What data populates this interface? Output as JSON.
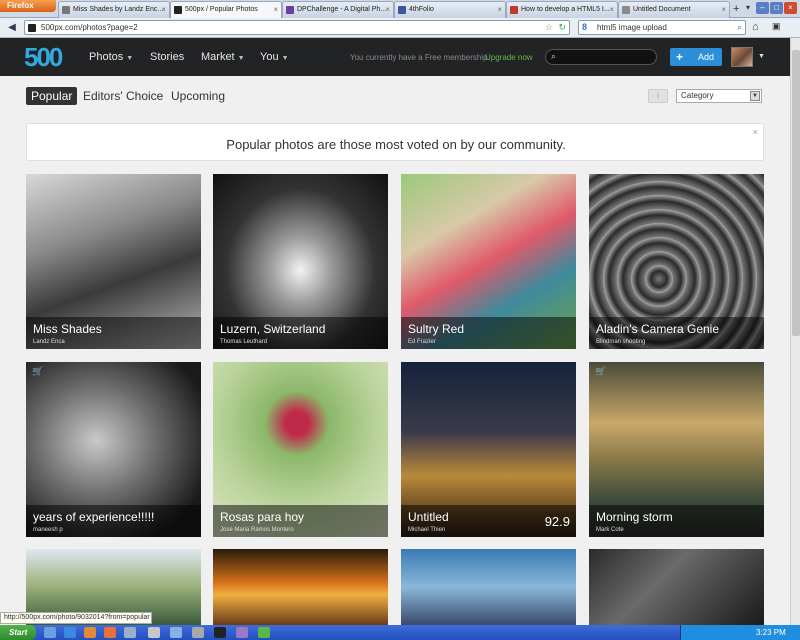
{
  "browser": {
    "menu_label": "Firefox",
    "tabs": [
      {
        "label": "Miss Shades by Landz Enc...",
        "active": false
      },
      {
        "label": "500px / Popular Photos",
        "active": true
      },
      {
        "label": "DPChallenge - A Digital Ph...",
        "active": false
      },
      {
        "label": "4thFolio",
        "active": false
      },
      {
        "label": "How to develop a HTML5 I...",
        "active": false
      },
      {
        "label": "Untitled Document",
        "active": false
      }
    ],
    "url": "500px.com/photos?page=2",
    "search_engine_label": "8",
    "search_query": "html5 image upload",
    "status_text": "http://500px.com/photo/9032014?from=popular"
  },
  "site": {
    "logo": "500",
    "nav": [
      {
        "label": "Photos",
        "has_caret": true
      },
      {
        "label": "Stories",
        "has_caret": false
      },
      {
        "label": "Market",
        "has_caret": true
      },
      {
        "label": "You",
        "has_caret": true
      }
    ],
    "membership_text": "You currently have a Free membership.",
    "upgrade_label": "Upgrade now",
    "add_label": "Add",
    "accent": "#2b8fd8"
  },
  "filters": {
    "tabs": [
      {
        "label": "Popular",
        "active": true
      },
      {
        "label": "Editors' Choice",
        "active": false
      },
      {
        "label": "Upcoming",
        "active": false
      }
    ],
    "category_label": "Category"
  },
  "banner": {
    "text": "Popular photos are those most voted on by our community."
  },
  "photos": [
    {
      "title": "Miss Shades",
      "author": "Landz Enca",
      "cart": false,
      "score": ""
    },
    {
      "title": "Luzern, Switzerland",
      "author": "Thomas Leuthard",
      "cart": false,
      "score": ""
    },
    {
      "title": "Sultry Red",
      "author": "Ed Frazier",
      "cart": false,
      "score": ""
    },
    {
      "title": "Aladin's Camera Genie",
      "author": "Blindman shooting",
      "cart": false,
      "score": ""
    },
    {
      "title": "years of experience!!!!!",
      "author": "maneesh p",
      "cart": true,
      "score": ""
    },
    {
      "title": "Rosas para hoy",
      "author": "Jose Maria Ramos Montero",
      "cart": false,
      "score": ""
    },
    {
      "title": "Untitled",
      "author": "Michael Thien",
      "cart": false,
      "score": "92.9"
    },
    {
      "title": "Morning storm",
      "author": "Mark Cote",
      "cart": true,
      "score": ""
    }
  ],
  "taskbar": {
    "start_label": "Start",
    "clock": "3:23 PM"
  }
}
